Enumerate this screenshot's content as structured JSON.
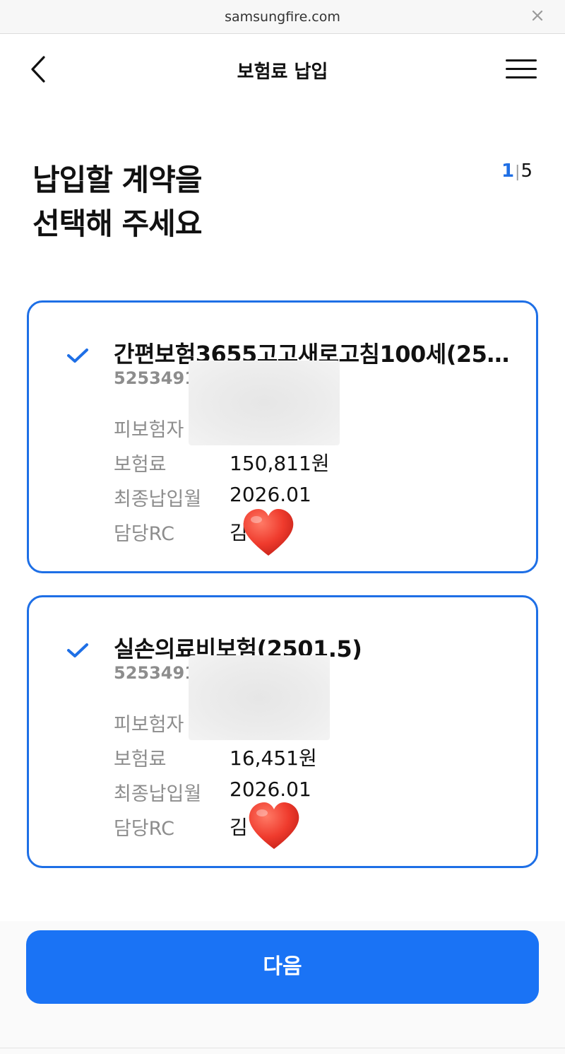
{
  "browser": {
    "url": "samsungfire.com"
  },
  "header": {
    "title": "보험료 납입"
  },
  "main": {
    "heading_line1": "납입할 계약을",
    "heading_line2": "선택해 주세요",
    "step_current": "1",
    "step_separator": "|",
    "step_total": "5"
  },
  "labels": {
    "insured": "피보험자",
    "premium": "보험료",
    "last_paid_month": "최종납입월",
    "rc": "담당RC"
  },
  "contracts": [
    {
      "name": "간편보험3655고고새로고침100세(25…",
      "number": "5253491",
      "premium": "150,811원",
      "last_paid_month": "2026.01",
      "rc": "김",
      "selected": true
    },
    {
      "name": "실손의료비보험(2501.5)",
      "number": "5253491",
      "premium": "16,451원",
      "last_paid_month": "2026.01",
      "rc": "김",
      "selected": true
    }
  ],
  "footer": {
    "next_label": "다음"
  },
  "colors": {
    "accent": "#1a73f5",
    "card_border": "#1e6fe6",
    "muted_text": "#8d8d8d",
    "heart": "#ef3b2d"
  },
  "icons": {
    "back": "chevron-left-icon",
    "menu": "hamburger-menu-icon",
    "close": "close-icon",
    "check": "check-icon",
    "heart": "heart-icon"
  }
}
